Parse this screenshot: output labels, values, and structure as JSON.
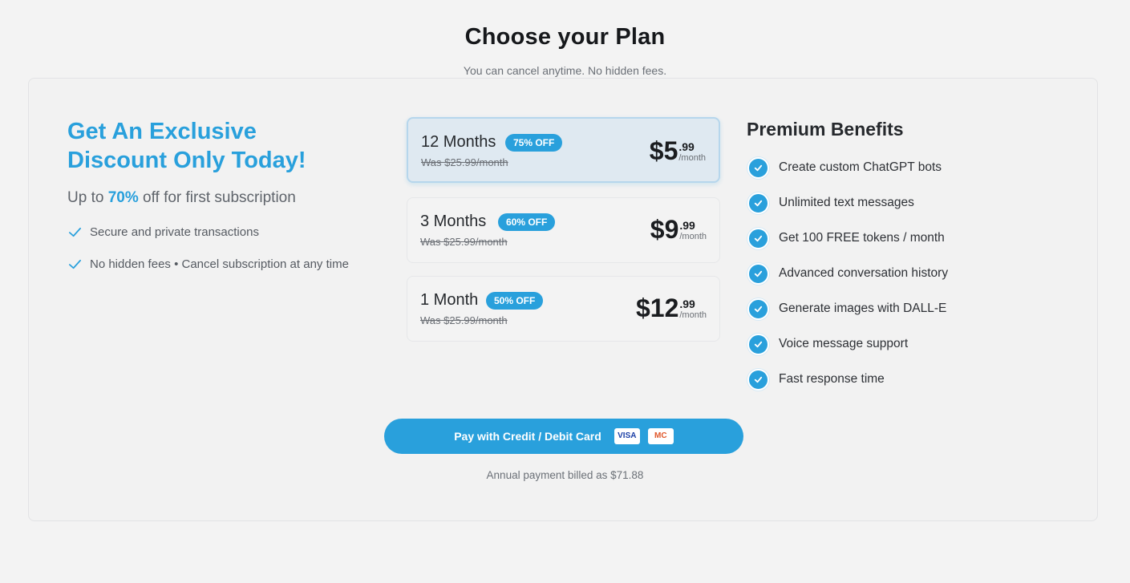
{
  "header": {
    "title": "Choose your Plan",
    "subtitle": "You can cancel anytime. No hidden fees."
  },
  "promo": {
    "heading": "Get An Exclusive Discount Only Today!",
    "sub_prefix": "Up to ",
    "sub_highlight": "70%",
    "sub_suffix": " off for first subscription",
    "checks": [
      "Secure and private transactions",
      "No hidden fees • Cancel subscription at any time"
    ]
  },
  "plans": [
    {
      "name": "12 Months",
      "badge": "75% OFF",
      "was": "Was $25.99/month",
      "price_main": "$5",
      "price_cents": ".99",
      "per": "/month",
      "selected": true
    },
    {
      "name": "3 Months",
      "badge": "60% OFF",
      "was": "Was $25.99/month",
      "price_main": "$9",
      "price_cents": ".99",
      "per": "/month",
      "selected": false
    },
    {
      "name": "1 Month",
      "badge": "50% OFF",
      "was": "Was $25.99/month",
      "price_main": "$12",
      "price_cents": ".99",
      "per": "/month",
      "selected": false
    }
  ],
  "benefits": {
    "title": "Premium Benefits",
    "items": [
      "Create custom ChatGPT bots",
      "Unlimited text messages",
      "Get 100 FREE tokens / month",
      "Advanced conversation history",
      "Generate images with DALL-E",
      "Voice message support",
      "Fast response time"
    ]
  },
  "payment": {
    "button_label": "Pay with Credit / Debit Card",
    "card_visa": "VISA",
    "card_mc": "MC",
    "note": "Annual payment billed as $71.88"
  },
  "colors": {
    "accent": "#29a0dc",
    "background": "#f3f3f3",
    "selected_plan_bg": "#dfe9f1"
  },
  "icons": {
    "check": "check-icon",
    "benefit": "check-circle-icon"
  }
}
